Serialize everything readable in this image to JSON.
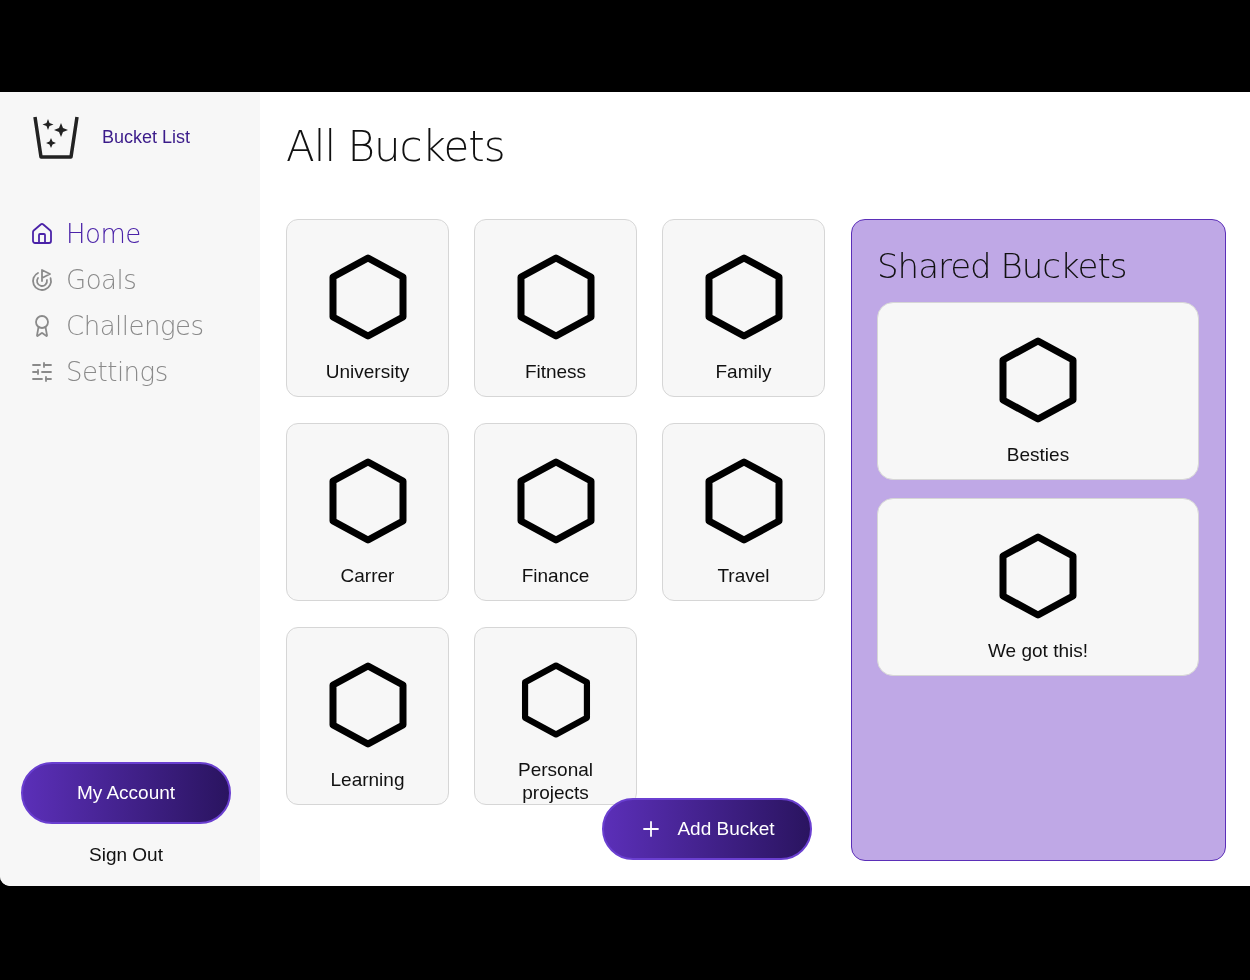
{
  "brand": {
    "name": "Bucket List"
  },
  "nav": [
    {
      "label": "Home",
      "kind": "home",
      "selected": true
    },
    {
      "label": "Goals",
      "kind": "goals",
      "selected": false
    },
    {
      "label": "Challenges",
      "kind": "challenges",
      "selected": false
    },
    {
      "label": "Settings",
      "kind": "settings",
      "selected": false
    }
  ],
  "account_button": "My Account",
  "sign_out": "Sign Out",
  "title": "All Buckets",
  "buckets": [
    {
      "name": "University"
    },
    {
      "name": "Fitness"
    },
    {
      "name": "Family"
    },
    {
      "name": "Carrer"
    },
    {
      "name": "Finance"
    },
    {
      "name": "Travel"
    },
    {
      "name": "Learning"
    },
    {
      "name": "Personal projects"
    }
  ],
  "add_button": "Add Bucket",
  "shared": {
    "title": "Shared Buckets",
    "buckets": [
      {
        "name": "Besties"
      },
      {
        "name": "We got this!"
      }
    ]
  }
}
